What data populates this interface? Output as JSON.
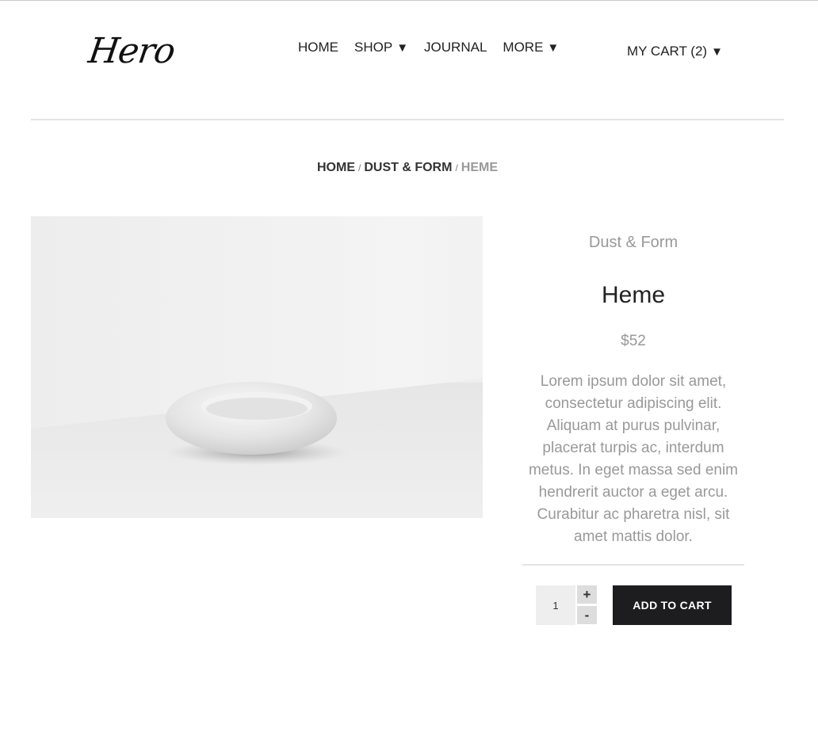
{
  "header": {
    "logo_text": "Hero",
    "nav": [
      {
        "label": "HOME",
        "has_caret": false
      },
      {
        "label": "SHOP",
        "has_caret": true
      },
      {
        "label": "JOURNAL",
        "has_caret": false
      },
      {
        "label": "MORE",
        "has_caret": true
      }
    ],
    "cart_label": "MY CART (2)",
    "caret_glyph": "▼"
  },
  "breadcrumb": {
    "home": "HOME",
    "category": "DUST & FORM",
    "current": "HEME",
    "separator": "/"
  },
  "product": {
    "image_alt": "ceramic-ring-object",
    "brand": "Dust & Form",
    "title": "Heme",
    "price": "$52",
    "description": "Lorem ipsum dolor sit amet, consectetur adipiscing elit. Aliquam at purus pulvinar, placerat turpis ac, interdum metus. In eget massa sed enim hendrerit auctor a eget arcu. Curabitur ac pharetra nisl, sit amet mattis dolor."
  },
  "purchase": {
    "quantity": "1",
    "plus_label": "+",
    "minus_label": "-",
    "add_to_cart_label": "ADD TO CART"
  },
  "colors": {
    "button_bg": "#1d1d1f",
    "muted_text": "#999999",
    "divider": "#e3e3e3"
  }
}
